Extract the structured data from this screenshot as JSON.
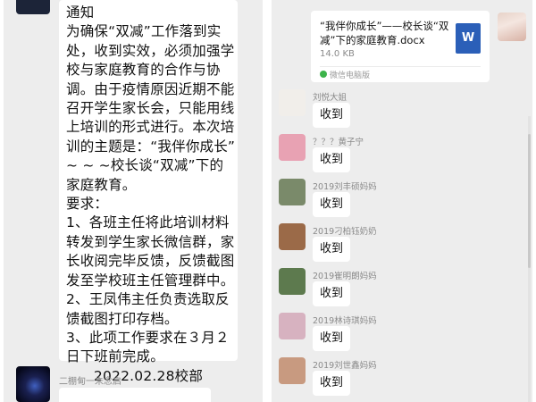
{
  "left_chat": {
    "notice_lines": [
      "通知",
      "  为确保“双减”工作落到实",
      "处，收到实效，必须加强学",
      "校与家庭教育的合作与协",
      "调。由于疫情原因近期不能",
      "召开学生家长会，只能用线",
      "上培训的形式进行。本次培",
      "训的主题是：“我伴你成长”",
      "~ ~ ~校长谈“双减”下的",
      "家庭教育。",
      "要求：",
      "  1、各班主任将此培训材料",
      "转发到学生家长微信群，家",
      "长收阅完毕反馈，反馈截图",
      "发至学校班主任管理群中。",
      "2、王凤伟主任负责选取反",
      "馈截图打印存档。",
      "3、此项工作要求在３月２",
      "日下班前完成。"
    ],
    "notice_date": "2022.02.28校部",
    "bottom_sender": "二棚甸一朱念启"
  },
  "right_chat": {
    "file": {
      "title": "“我伴你成长”——校长谈“双减”下的家庭教育.docx",
      "size": "14.0 KB",
      "source": "微信电脑版",
      "icon_letter": "W"
    },
    "messages": [
      {
        "name": "刘悦大姐",
        "text": "收到",
        "avatar_color": "#f1eeea"
      },
      {
        "name": "？？？黄子宁",
        "text": "收到",
        "avatar_color": "#e8a2b3"
      },
      {
        "name": "2019刘丰硕妈妈",
        "text": "收到",
        "avatar_color": "#7a8a6a"
      },
      {
        "name": "2019刁柏钰奶奶",
        "text": "收到",
        "avatar_color": "#9b6a48"
      },
      {
        "name": "2019崔明朗妈妈",
        "text": "收到",
        "avatar_color": "#5d7a4e"
      },
      {
        "name": "2019林诗琪妈妈",
        "text": "收到",
        "avatar_color": "#d7b2c0"
      },
      {
        "name": "2019刘世鑫妈妈",
        "text": "收到",
        "avatar_color": "#c89a80"
      }
    ]
  }
}
